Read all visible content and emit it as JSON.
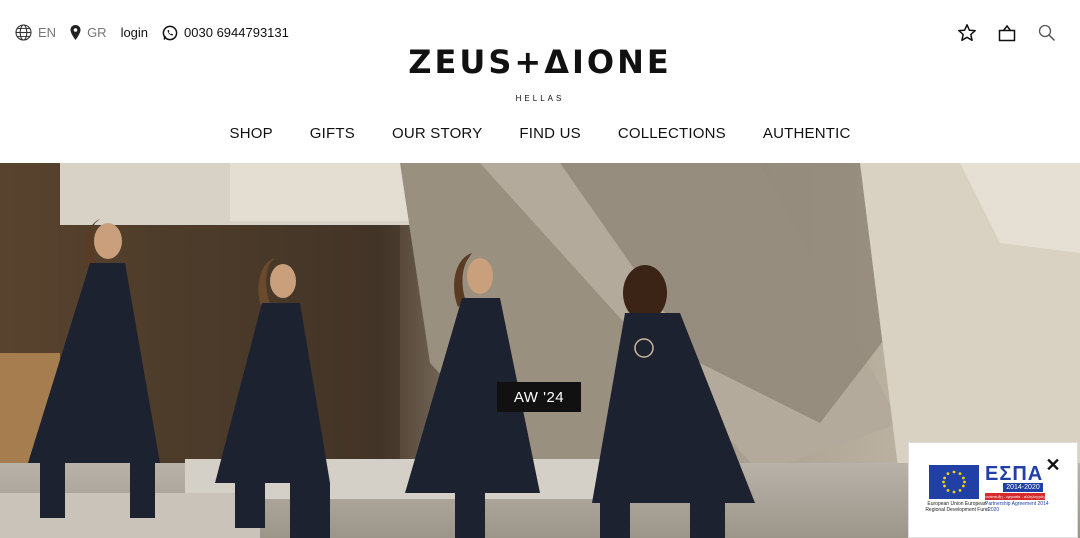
{
  "topbar": {
    "language": {
      "icon": "globe-icon",
      "label": "EN"
    },
    "location": {
      "icon": "location-pin-icon",
      "label": "GR"
    },
    "login_label": "login",
    "phone": {
      "icon": "whatsapp-icon",
      "label": "0030 6944793131"
    }
  },
  "header_icons": [
    "star-icon",
    "bag-icon",
    "search-icon"
  ],
  "logo": {
    "wordmark": "ZEUS+ΔIONE",
    "subtitle": "HELLAS"
  },
  "nav": {
    "items": [
      "SHOP",
      "GIFTS",
      "OUR STORY",
      "FIND US",
      "COLLECTIONS",
      "AUTHENTIC"
    ]
  },
  "hero": {
    "badge_label": "AW '24"
  },
  "espa_banner": {
    "close_label": "✕",
    "eu_caption": "European Union European Regional Development Fund",
    "espa_title": "ΕΣΠΑ",
    "espa_years": "2014-2020",
    "espa_sub": "ανάπτυξη - εργασία - αλληλεγγύη",
    "espa_caption": "Partnership Agreement 2014 - 2020"
  },
  "colors": {
    "text": "#111111",
    "muted": "#777777",
    "espa_blue": "#2140a6",
    "espa_red": "#d52b2b"
  }
}
